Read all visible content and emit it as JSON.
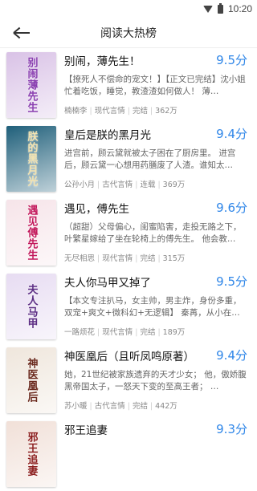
{
  "statusbar": {
    "time": "10:20"
  },
  "header": {
    "title": "阅读大热榜"
  },
  "books": [
    {
      "title": "别闹，薄先生！",
      "score": "9.5分",
      "desc": "【撩死人不偿命的宠文！】【正文已完结】沈小姐忙着吃饭，睡觉，教渣渣如何做人！ 薄…",
      "author": "楠楠李",
      "category": "现代言情",
      "status": "完结",
      "words": "362万",
      "cover_text": "别闹薄先生",
      "cover_bg": "#d9c2e6",
      "cover_fg": "#8a3fb0"
    },
    {
      "title": "皇后是朕的黑月光",
      "score": "9.4分",
      "desc": "进宫前，顾云黛就被太子困在了厨房里。 进宫后，顾云黛一心想用药膳废了人渣。谁知太…",
      "author": "公孙小月",
      "category": "古代言情",
      "status": "连载",
      "words": "369万",
      "cover_text": "朕的黑月光",
      "cover_bg": "#1f5f7a",
      "cover_fg": "#f3e3b0"
    },
    {
      "title": "遇见，傅先生",
      "score": "9.6分",
      "desc": "（超甜）父母偏心，闺蜜陷害，走投无路之下，叶繁星嫁给了坐在轮椅上的傅先生。 他会教…",
      "author": "无尽相思",
      "category": "现代言情",
      "status": "完结",
      "words": "315万",
      "cover_text": "遇见傅先生",
      "cover_bg": "#f6e4e9",
      "cover_fg": "#c2185b"
    },
    {
      "title": "夫人你马甲又掉了",
      "score": "9.5分",
      "desc": "【本文专注扒马，女主帅，男主炸，身份多重，双宠+爽文+微科幻+无逻辑】 秦苒，从小在…",
      "author": "一路烦花",
      "category": "现代言情",
      "status": "完结",
      "words": "189万",
      "cover_text": "夫人马甲",
      "cover_bg": "#e7dcf2",
      "cover_fg": "#5b2c83"
    },
    {
      "title": "神医凰后（且听凤鸣原著）",
      "score": "9.4分",
      "desc": "她，21世纪被家族遗弃的天才少女； 他，傲娇腹黑帝国太子，一怒天下变的至高王者； …",
      "author": "苏小暖",
      "category": "古代言情",
      "status": "完结",
      "words": "442万",
      "cover_text": "神医凰后",
      "cover_bg": "#efe6dc",
      "cover_fg": "#6b2a1e"
    },
    {
      "title": "邪王追妻",
      "score": "9.3分",
      "desc": "",
      "author": "",
      "category": "",
      "status": "",
      "words": "",
      "cover_text": "邪王追妻",
      "cover_bg": "#f1e0d8",
      "cover_fg": "#8b1d1d"
    }
  ]
}
